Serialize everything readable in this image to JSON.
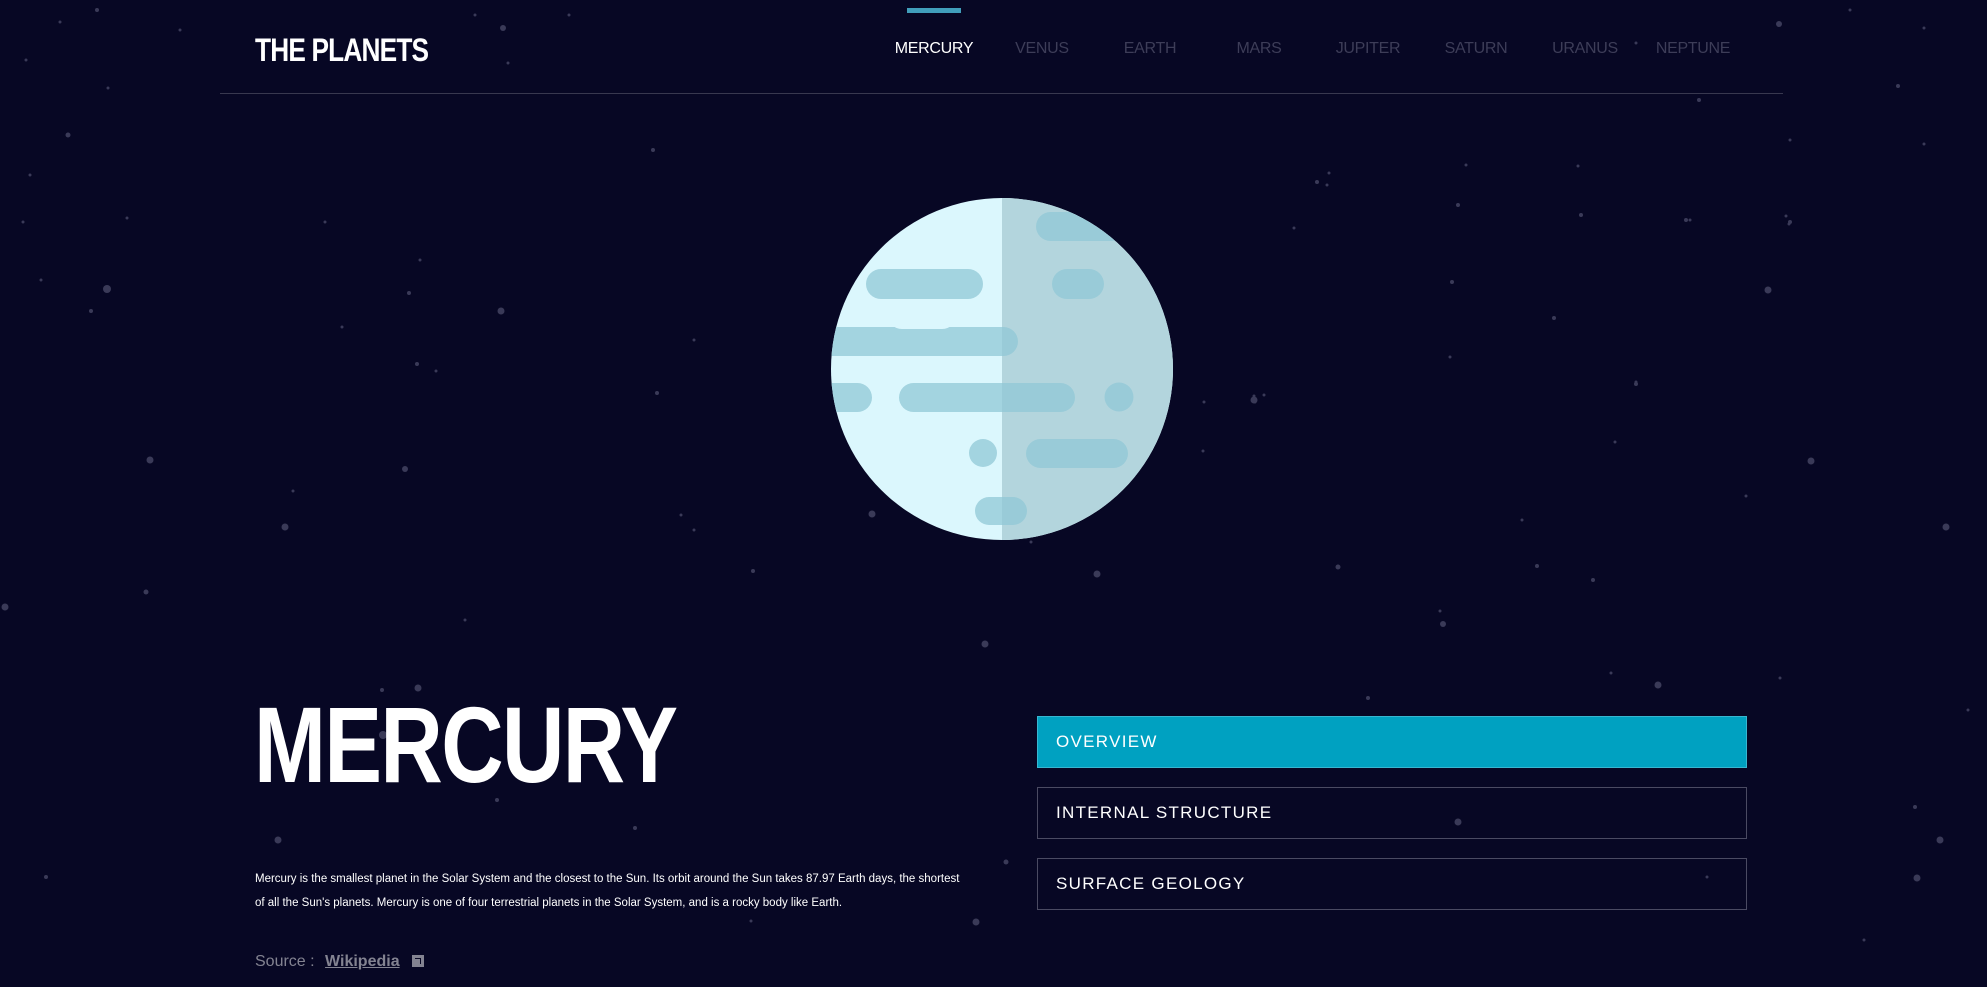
{
  "brand": {
    "logo": "THE PLANETS"
  },
  "nav": {
    "items": [
      "MERCURY",
      "VENUS",
      "EARTH",
      "MARS",
      "JUPITER",
      "SATURN",
      "URANUS",
      "NEPTUNE"
    ],
    "active": "MERCURY"
  },
  "planet": {
    "name": "MERCURY",
    "description": "Mercury is the smallest planet in the Solar System and the closest to the Sun. Its orbit around the Sun takes 87.97 Earth days, the shortest of all the Sun's planets. Mercury is one of four terrestrial planets in the Solar System, and is a rocky body like Earth.",
    "source_label": "Source :",
    "source_link": "Wikipedia",
    "source_icon": "external-link-icon"
  },
  "tabs": [
    {
      "label": "OVERVIEW",
      "active": true
    },
    {
      "label": "INTERNAL STRUCTURE",
      "active": false
    },
    {
      "label": "SURFACE GEOLOGY",
      "active": false
    }
  ],
  "colors": {
    "background": "#070724",
    "accent": "#00a1c1",
    "nav_indicator": "#419ebb",
    "inactive_nav": "#3d3d58",
    "planet_light": "#dbf7fd",
    "planet_shadow": "#c3e0e6",
    "planet_crater": "#a3d4e0"
  }
}
